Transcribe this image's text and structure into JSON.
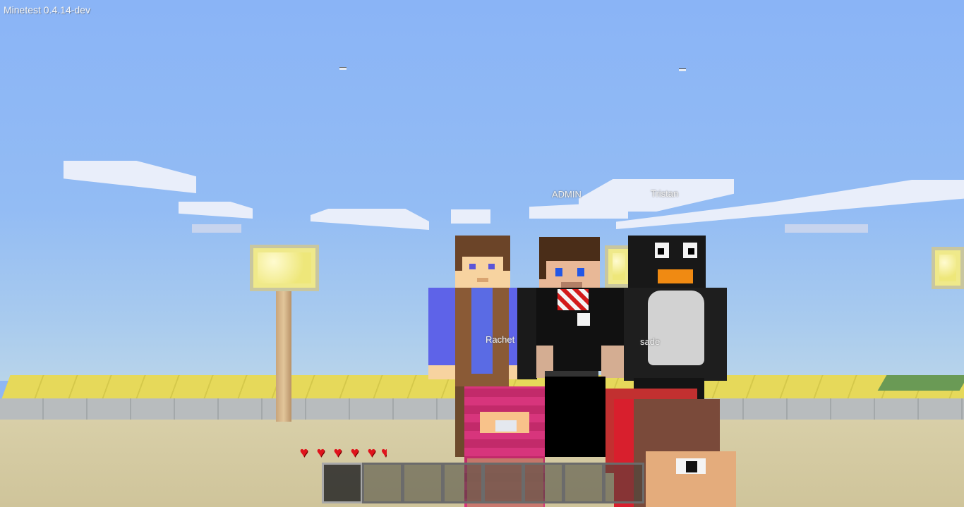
{
  "hud": {
    "title": "Minetest 0.4.14-dev"
  },
  "players": [
    {
      "name": "ADMIN"
    },
    {
      "name": "Tristan"
    },
    {
      "name": "Rachet"
    },
    {
      "name": "sade"
    }
  ],
  "health": {
    "hearts_shown": 6,
    "icon": "heart-icon"
  },
  "hotbar": {
    "slots": 8,
    "selected_slot": 1
  },
  "colors": {
    "sky": "#8fb7f4",
    "heart": "#e0131c"
  }
}
